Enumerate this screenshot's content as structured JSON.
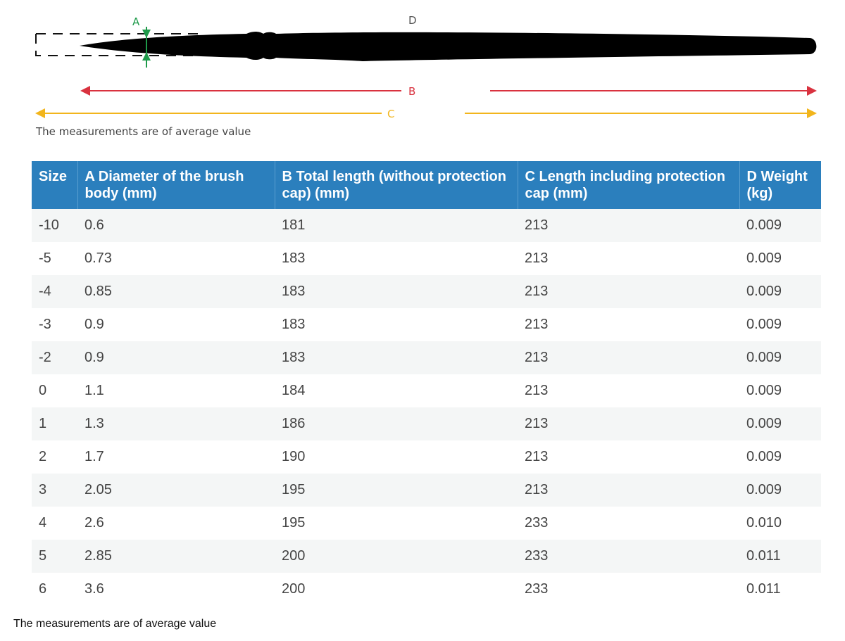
{
  "diagram": {
    "label_a": "A",
    "label_b": "B",
    "label_c": "C",
    "label_d": "D",
    "note": "The measurements are of average value",
    "colors": {
      "a": "#1e9a4a",
      "b": "#d9323f",
      "c": "#f2b51c",
      "d": "#555555",
      "brush": "#000000"
    }
  },
  "table": {
    "headers": [
      "Size",
      "A Diameter of the brush body (mm)",
      "B Total length (without protection cap) (mm)",
      "C Length including protection cap (mm)",
      "D Weight (kg)"
    ],
    "rows": [
      [
        "-10",
        "0.6",
        "181",
        "213",
        "0.009"
      ],
      [
        "-5",
        "0.73",
        "183",
        "213",
        "0.009"
      ],
      [
        "-4",
        "0.85",
        "183",
        "213",
        "0.009"
      ],
      [
        "-3",
        "0.9",
        "183",
        "213",
        "0.009"
      ],
      [
        "-2",
        "0.9",
        "183",
        "213",
        "0.009"
      ],
      [
        "0",
        "1.1",
        "184",
        "213",
        "0.009"
      ],
      [
        "1",
        "1.3",
        "186",
        "213",
        "0.009"
      ],
      [
        "2",
        "1.7",
        "190",
        "213",
        "0.009"
      ],
      [
        "3",
        "2.05",
        "195",
        "213",
        "0.009"
      ],
      [
        "4",
        "2.6",
        "195",
        "233",
        "0.010"
      ],
      [
        "5",
        "2.85",
        "200",
        "233",
        "0.011"
      ],
      [
        "6",
        "3.6",
        "200",
        "233",
        "0.011"
      ]
    ],
    "header_color": "#2b7fbd"
  },
  "footer": {
    "note": "The measurements are of average value"
  }
}
